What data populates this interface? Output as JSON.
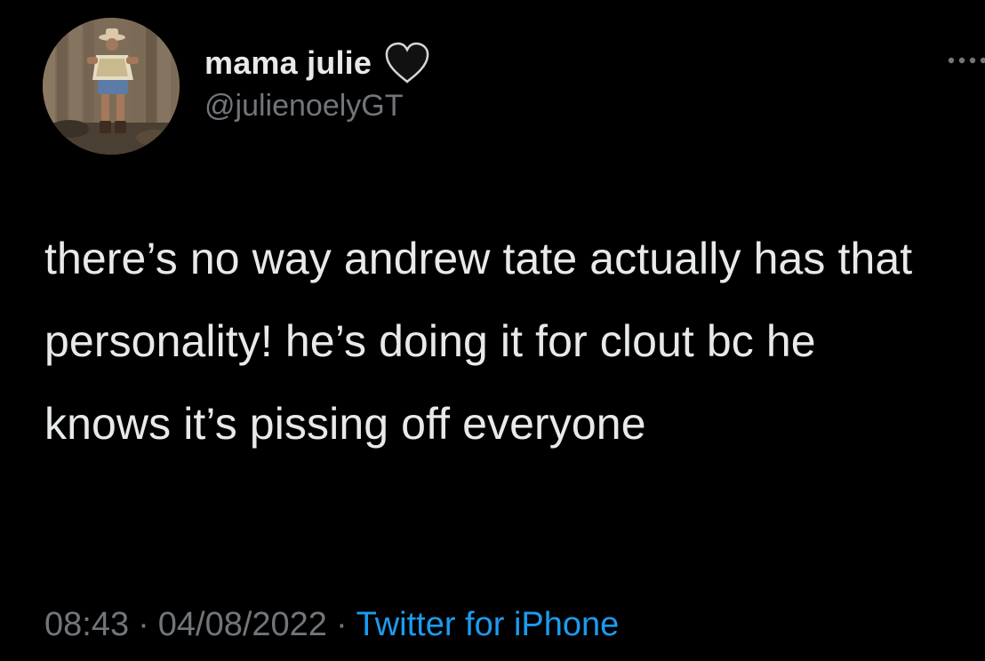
{
  "user": {
    "display_name": "mama julie",
    "handle": "@julienoelyGT",
    "badge_icon": "black-heart-icon"
  },
  "tweet": {
    "text": "there’s no way andrew tate actually has that personality! he’s doing it for clout bc he knows it’s pissing off everyone"
  },
  "meta": {
    "time": "08:43",
    "separator": "·",
    "date": "04/08/2022",
    "source": "Twitter for iPhone"
  },
  "colors": {
    "background": "#000000",
    "text_primary": "#e7e9ea",
    "text_secondary": "#71767b",
    "link": "#1d9bf0"
  },
  "icons": {
    "more": "more-options-icon",
    "avatar": "profile-avatar"
  }
}
